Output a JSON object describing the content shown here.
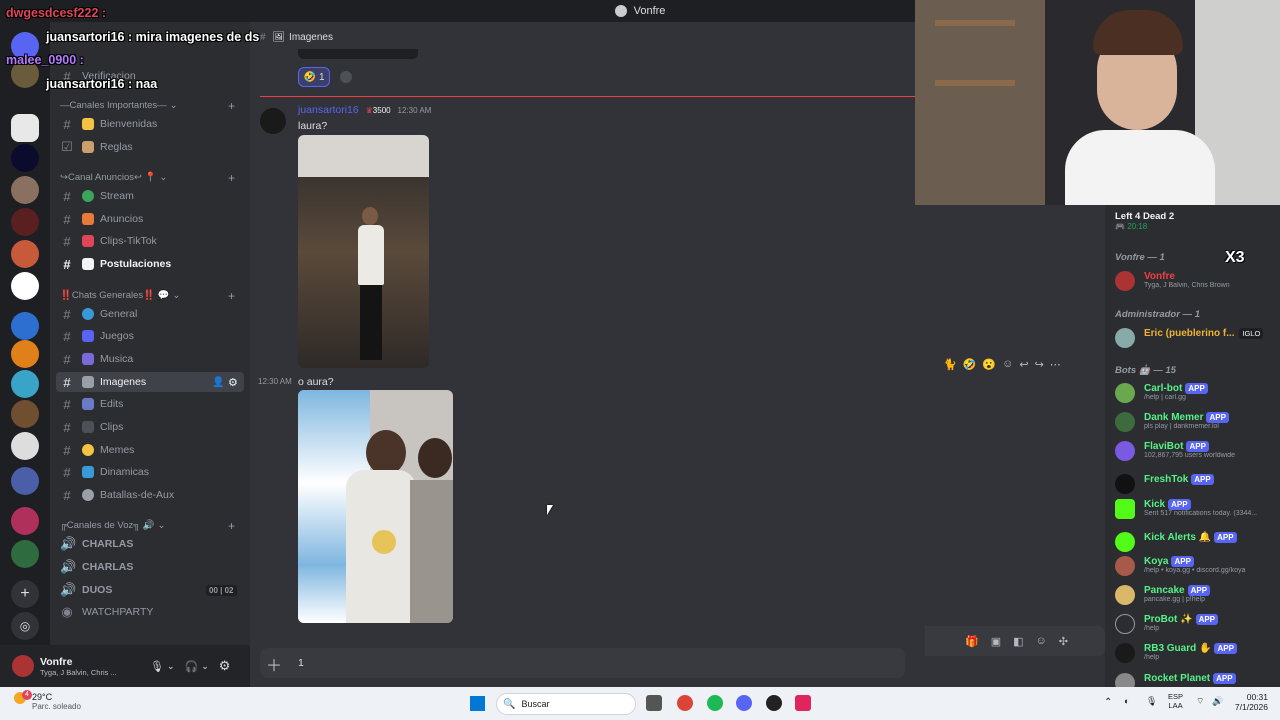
{
  "window": {
    "title": "Vonfre"
  },
  "stream_overlay": {
    "messages": [
      {
        "user": "dwgesdcesf222",
        "text": ""
      },
      {
        "user": "juansartori16",
        "text": "mira imagenes de ds"
      },
      {
        "user": "malee_0900",
        "text": ""
      },
      {
        "user": "juansartori16",
        "text": "naa"
      }
    ],
    "counter": "X3"
  },
  "channel_header": {
    "name": "Imagenes"
  },
  "sidebar": {
    "top_channel": "Verificacion",
    "categories": [
      {
        "name": "—Canales Importantes—",
        "channels": [
          "Bienvenidas",
          "Reglas"
        ]
      },
      {
        "name": "↪Canal Anuncios↩ 📍",
        "channels": [
          "Stream",
          "Anuncios",
          "Clips-TikTok",
          "Postulaciones"
        ]
      },
      {
        "name": "‼️Chats Generales‼️ 💬",
        "channels": [
          "General",
          "Juegos",
          "Musica",
          "Imagenes",
          "Edits",
          "Clips",
          "Memes",
          "Dinamicas",
          "Batallas-de-Aux"
        ]
      },
      {
        "name": "╔Canales de Voz╗ 🔊",
        "channels": [
          "CHARLAS",
          "CHARLAS",
          "DUOS",
          "WATCHPARTY"
        ]
      }
    ],
    "duos_counts": [
      "00",
      "02"
    ]
  },
  "user_panel": {
    "name": "Vonfre",
    "status": "Tyga, J Balvin, Chris ..."
  },
  "chat": {
    "reaction_count": "1",
    "new_divider": "",
    "messages": [
      {
        "author": "juansartori16",
        "role_badge": "3500",
        "time": "12:30 AM",
        "text": "laura?"
      },
      {
        "time": "12:30 AM",
        "text": "o aura?"
      }
    ],
    "composer_value": "1"
  },
  "members": {
    "game": {
      "name": "Left 4 Dead 2",
      "time": "20:18"
    },
    "groups": [
      {
        "title": "Vonfre — 1",
        "members": [
          {
            "name": "Vonfre",
            "status": "Tyga, J Balvin, Chris Brown",
            "color": "#f23f43"
          }
        ]
      },
      {
        "title": "Administrador — 1",
        "members": [
          {
            "name": "Eric (pueblerino f...",
            "status": "",
            "color": "#f0b232",
            "tag": "IGLO"
          }
        ]
      },
      {
        "title": "Bots 🤖 — 15",
        "members": [
          {
            "name": "Carl-bot",
            "status": "/help | carl.gg",
            "color": "#57f287",
            "app": "APP"
          },
          {
            "name": "Dank Memer",
            "status": "pls play | dankmemer.lol",
            "color": "#57f287",
            "app": "APP"
          },
          {
            "name": "FlaviBot",
            "status": "102,867,795 users worldwide",
            "color": "#57f287",
            "app": "APP"
          },
          {
            "name": "FreshTok",
            "status": "",
            "color": "#57f287",
            "app": "APP"
          },
          {
            "name": "Kick",
            "status": "Sent 517 notifications today. (3344...",
            "color": "#57f287",
            "app": "APP"
          },
          {
            "name": "Kick Alerts 🔔",
            "status": "",
            "color": "#57f287",
            "app": "APP"
          },
          {
            "name": "Koya",
            "status": "/help • koya.gg • discord.gg/koya",
            "color": "#57f287",
            "app": "APP"
          },
          {
            "name": "Pancake",
            "status": "pancake.gg | p!help",
            "color": "#57f287",
            "app": "APP"
          },
          {
            "name": "ProBot ✨",
            "status": "/help",
            "color": "#57f287",
            "app": "APP"
          },
          {
            "name": "RB3 Guard ✋",
            "status": "/help",
            "color": "#57f287",
            "app": "APP"
          },
          {
            "name": "Rocket Planet",
            "status": "",
            "color": "#57f287",
            "app": "APP"
          }
        ]
      }
    ]
  },
  "taskbar": {
    "weather_temp": "29°C",
    "weather_desc": "Parc. soleado",
    "search_label": "Buscar",
    "lang_top": "ESP",
    "lang_bottom": "LAA",
    "time": "00:31",
    "date": "7/1/2026",
    "notif": "4"
  }
}
